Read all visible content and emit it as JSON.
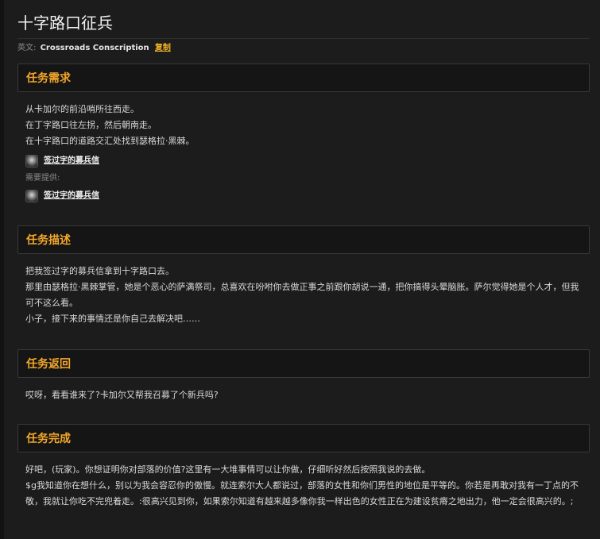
{
  "page": {
    "title": "十字路口征兵",
    "english_label": "英文:",
    "english_name": "Crossroads Conscription",
    "copy_label": "复制"
  },
  "requirements": {
    "header": "任务需求",
    "lines": [
      "从卡加尔的前沿哨所往西走。",
      "在丁字路口往左拐，然后朝南走。",
      "在十字路口的道路交汇处找到瑟格拉·黑棘。"
    ],
    "item_icon": "letter-icon",
    "item_name": "签过字的募兵信",
    "provided_label": "需要提供:",
    "provided_item_name": "签过字的募兵信"
  },
  "description": {
    "header": "任务描述",
    "lines": [
      "把我签过字的募兵信拿到十字路口去。",
      "那里由瑟格拉·黑棘掌管，她是个恶心的萨满祭司，总喜欢在吩咐你去做正事之前跟你胡说一通，把你搞得头晕脑胀。萨尔觉得她是个人才，但我可不这么看。",
      "小子，接下来的事情还是你自己去解决吧……"
    ]
  },
  "return": {
    "header": "任务返回",
    "lines": [
      "哎呀，看看谁来了?卡加尔又帮我召募了个新兵吗?"
    ]
  },
  "completion": {
    "header": "任务完成",
    "lines": [
      "好吧，(玩家)。你想证明你对部落的价值?这里有一大堆事情可以让你做，仔细听好然后按照我说的去做。",
      "$g我知道你在想什么，别以为我会容忍你的傲慢。就连索尔大人都说过，部落的女性和你们男性的地位是平等的。你若是再敢对我有一丁点的不敬，我就让你吃不完兜着走。:很高兴见到你，如果索尔知道有越来越多像你我一样出色的女性正在为建设贫瘠之地出力，他一定会很高兴的。;"
    ]
  }
}
